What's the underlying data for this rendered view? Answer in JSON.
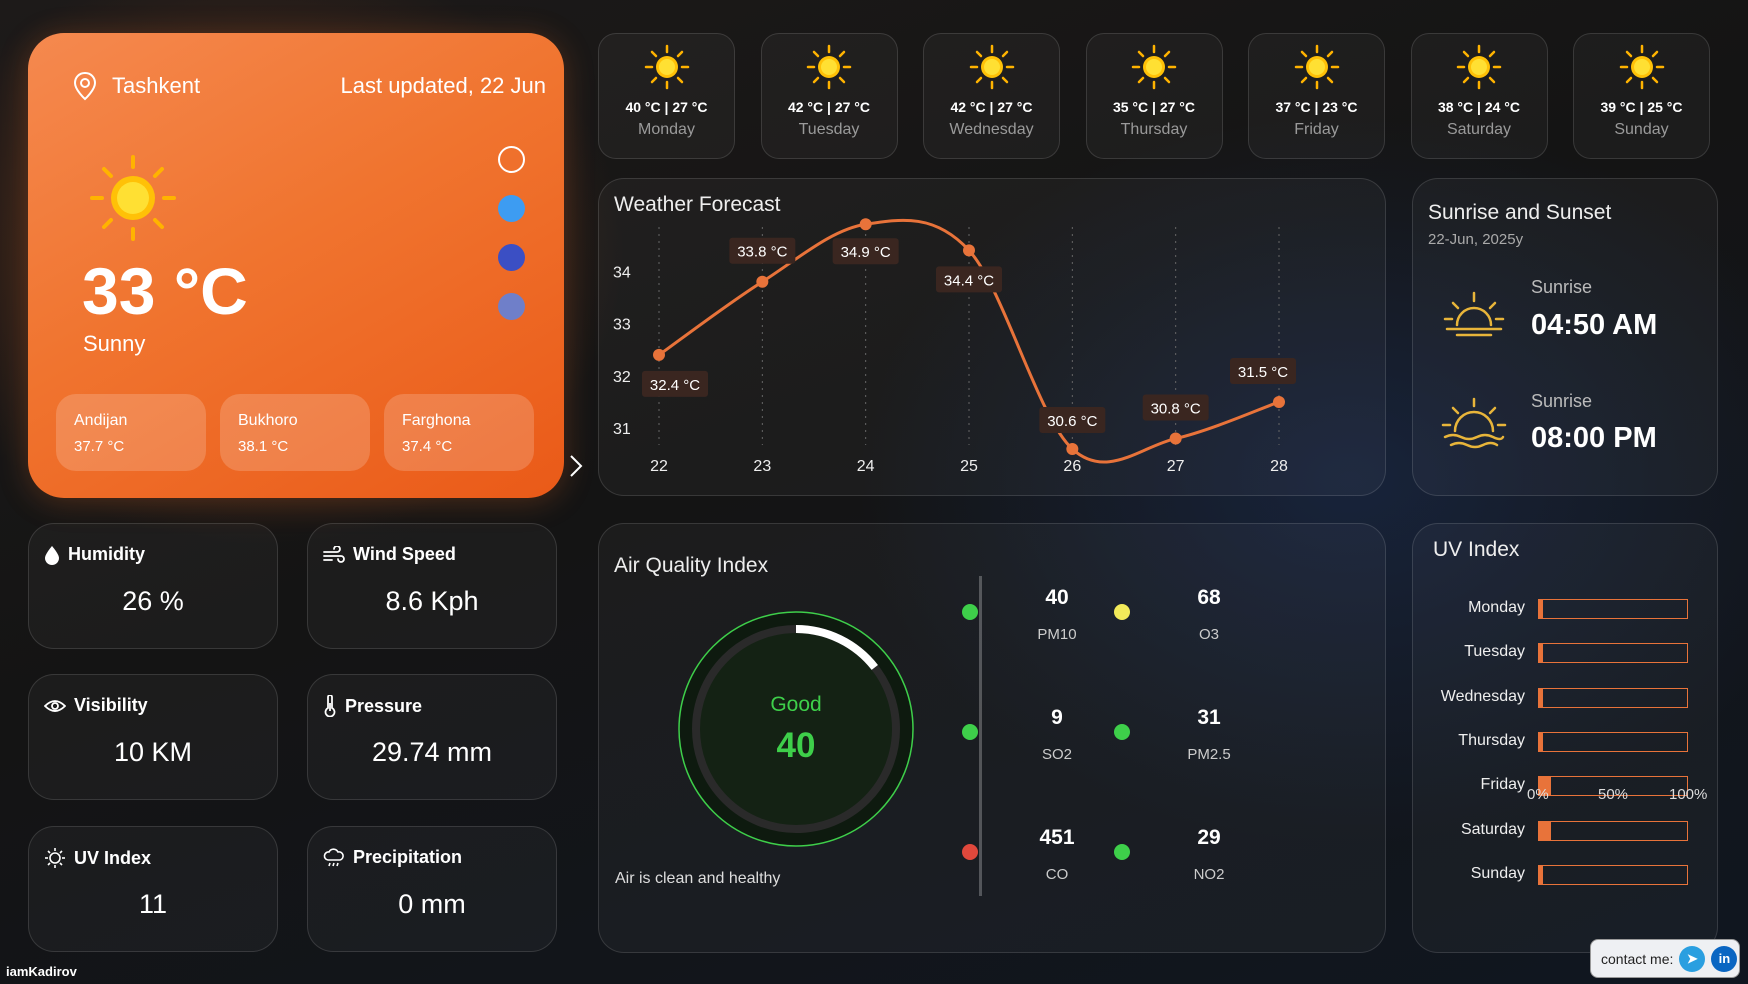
{
  "main": {
    "city": "Tashkent",
    "updated": "Last updated, 22 Jun",
    "temp": "33 °C",
    "condition": "Sunny",
    "theme_dots": [
      "#ffffff",
      "#3d9cf2",
      "#3b4fc4",
      "#6f7fc9"
    ],
    "cities": [
      {
        "name": "Andijan",
        "temp": "37.7 °C"
      },
      {
        "name": "Bukhoro",
        "temp": "38.1 °C"
      },
      {
        "name": "Farghona",
        "temp": "37.4 °C"
      }
    ]
  },
  "days": [
    {
      "temps": "40 °C | 27 °C",
      "name": "Monday"
    },
    {
      "temps": "42 °C | 27 °C",
      "name": "Tuesday"
    },
    {
      "temps": "42 °C | 27 °C",
      "name": "Wednesday"
    },
    {
      "temps": "35 °C | 27 °C",
      "name": "Thursday"
    },
    {
      "temps": "37 °C | 23 °C",
      "name": "Friday"
    },
    {
      "temps": "38 °C | 24 °C",
      "name": "Saturday"
    },
    {
      "temps": "39 °C | 25 °C",
      "name": "Sunday"
    }
  ],
  "forecast": {
    "title": "Weather Forecast",
    "chart_data": {
      "type": "line",
      "x": [
        22,
        23,
        24,
        25,
        26,
        27,
        28
      ],
      "values": [
        32.4,
        33.8,
        34.9,
        34.4,
        30.6,
        30.8,
        31.5
      ],
      "labels": [
        "32.4 °C",
        "33.8 °C",
        "34.9 °C",
        "34.4 °C",
        "30.6 °C",
        "30.8 °C",
        "31.5 °C"
      ],
      "y_ticks": [
        31,
        32,
        33,
        34
      ],
      "ylim": [
        30.6,
        35
      ],
      "color": "#e8733a"
    }
  },
  "sun": {
    "title": "Sunrise and Sunset",
    "date": "22-Jun, 2025y",
    "rise_label": "Sunrise",
    "rise_time": "04:50 AM",
    "set_label": "Sunrise",
    "set_time": "08:00 PM"
  },
  "stats": {
    "humidity": {
      "label": "Humidity",
      "value": "26 %"
    },
    "wind": {
      "label": "Wind Speed",
      "value": "8.6 Kph"
    },
    "visibility": {
      "label": "Visibility",
      "value": "10 KM"
    },
    "pressure": {
      "label": "Pressure",
      "value": "29.74 mm"
    },
    "uv": {
      "label": "UV Index",
      "value": "11"
    },
    "precip": {
      "label": "Precipitation",
      "value": "0 mm"
    }
  },
  "aqi": {
    "title": "Air Quality Index",
    "status": "Good",
    "value": "40",
    "message": "Air is clean and healthy",
    "pollutants": [
      {
        "value": "40",
        "name": "PM10",
        "color": "#3ecf4a"
      },
      {
        "value": "68",
        "name": "O3",
        "color": "#f2ea5a"
      },
      {
        "value": "9",
        "name": "SO2",
        "color": "#3ecf4a"
      },
      {
        "value": "31",
        "name": "PM2.5",
        "color": "#3ecf4a"
      },
      {
        "value": "451",
        "name": "CO",
        "color": "#e0483c"
      },
      {
        "value": "29",
        "name": "NO2",
        "color": "#3ecf4a"
      }
    ]
  },
  "uv_index": {
    "title": "UV Index",
    "days": [
      {
        "name": "Monday",
        "fraction": 0.03
      },
      {
        "name": "Tuesday",
        "fraction": 0.03
      },
      {
        "name": "Wednesday",
        "fraction": 0.03
      },
      {
        "name": "Thursday",
        "fraction": 0.03
      },
      {
        "name": "Friday",
        "fraction": 0.08
      },
      {
        "name": "Saturday",
        "fraction": 0.08
      },
      {
        "name": "Sunday",
        "fraction": 0.03
      }
    ],
    "axis": [
      "0%",
      "50%",
      "100%"
    ]
  },
  "footer": {
    "credit": "iamKadirov",
    "contact": "contact me:"
  }
}
